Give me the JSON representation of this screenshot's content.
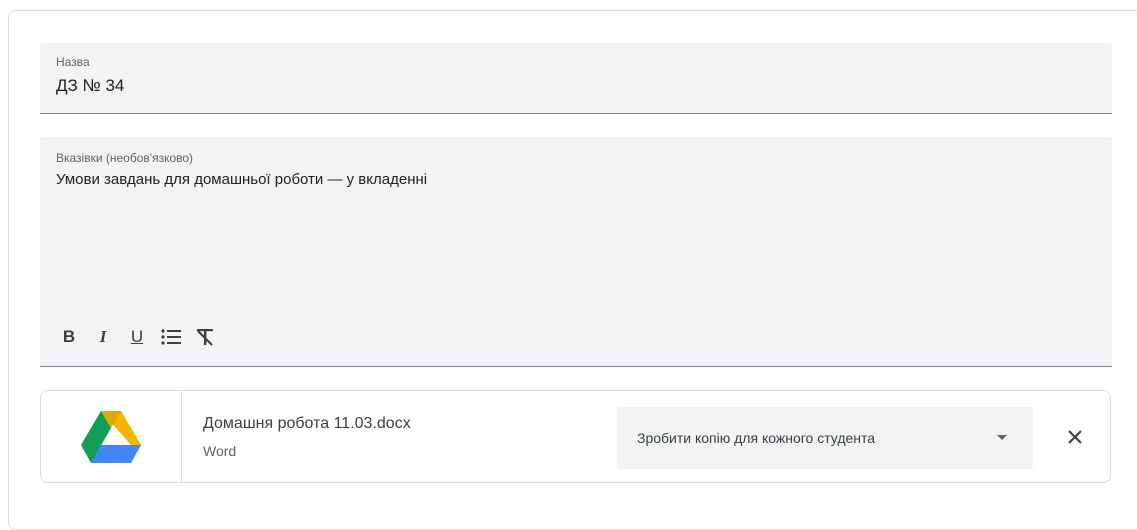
{
  "title_field": {
    "label": "Назва",
    "value": "ДЗ № 34"
  },
  "instructions_field": {
    "label": "Вказівки (необов'язково)",
    "value": "Умови завдань для домашньої роботи — у вкладенні"
  },
  "toolbar": {
    "bold_label": "B",
    "italic_label": "I",
    "underline_label": "U",
    "list_icon": "bulleted-list-icon",
    "clear_format_icon": "clear-formatting-icon"
  },
  "attachment": {
    "icon": "google-drive-icon",
    "file_name": "Домашня робота 11.03.docx",
    "file_type": "Word",
    "share_option": "Зробити копію для кожного студента",
    "remove_icon": "close-icon"
  },
  "colors": {
    "field_bg": "#f1f3f4",
    "drive_green": "#0f9d58",
    "drive_yellow": "#f4b400",
    "drive_blue": "#4285f4"
  }
}
